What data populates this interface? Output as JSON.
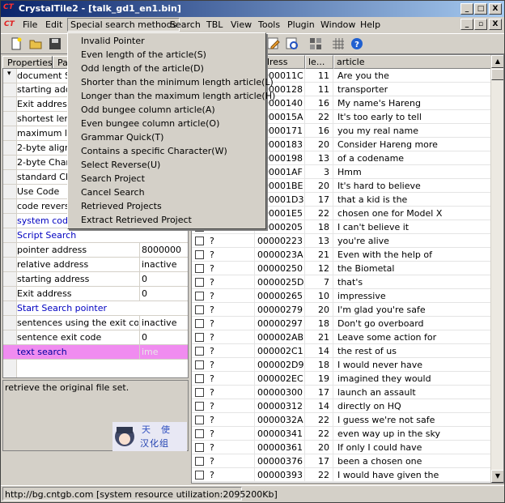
{
  "window": {
    "title": "CrystalTile2 - [talk_gd1_en1.bin]",
    "logo": "CT",
    "controls": [
      "_",
      "□",
      "X"
    ],
    "child_controls": [
      "_",
      "▫",
      "X"
    ]
  },
  "menubar": {
    "items": [
      "File",
      "Edit",
      "Special search methods",
      "Search",
      "TBL",
      "View",
      "Tools",
      "Plugin",
      "Window",
      "Help"
    ]
  },
  "dropdown": {
    "items": [
      "Invalid Pointer",
      "Even length of the article(S)",
      "Odd length of the article(D)",
      "Shorter than the minimum length article(L)",
      "Longer than the maximum length article(H)",
      "Odd bungee column article(A)",
      "Even bungee column article(O)",
      "Grammar Quick(T)",
      "Contains a specific Character(W)",
      "Select Reverse(U)",
      "Search Project",
      "Cancel Search",
      "Retrieved Projects",
      "Extract Retrieved Project"
    ]
  },
  "leftpanel": {
    "tabs": [
      "Properties",
      "Pa"
    ],
    "properties": [
      {
        "name": "document Se",
        "value": "",
        "type": "header"
      },
      {
        "name": "starting addr",
        "value": ""
      },
      {
        "name": "Exit address",
        "value": ""
      },
      {
        "name": "shortest leng",
        "value": ""
      },
      {
        "name": "maximum len",
        "value": ""
      },
      {
        "name": "2-byte alignm",
        "value": ""
      },
      {
        "name": "2-byte Chara",
        "value": ""
      },
      {
        "name": "standard Ch",
        "value": ""
      },
      {
        "name": "Use Code",
        "value": ""
      },
      {
        "name": "code reverse",
        "value": ""
      },
      {
        "name": "system code",
        "value": "",
        "type": "section"
      },
      {
        "name": "Script Search",
        "value": "",
        "type": "section"
      },
      {
        "name": "pointer address",
        "value": "8000000"
      },
      {
        "name": "relative address",
        "value": "inactive"
      },
      {
        "name": "starting address",
        "value": "0"
      },
      {
        "name": "Exit address",
        "value": "0"
      },
      {
        "name": "Start Search pointer",
        "value": "",
        "type": "section"
      },
      {
        "name": "sentences using the exit code",
        "value": "inactive"
      },
      {
        "name": "sentence exit code",
        "value": "0"
      },
      {
        "name": "text search",
        "value": "ime",
        "type": "highlight"
      }
    ],
    "description": "retrieve the original file set.",
    "mascot_text": [
      "天",
      "使",
      "汉化组"
    ]
  },
  "grid": {
    "columns": [
      "",
      "ddress",
      "le...",
      "article"
    ],
    "rows": [
      {
        "q": "",
        "address": "0000011C",
        "length": "11",
        "article": "Are you the"
      },
      {
        "q": "",
        "address": "00000128",
        "length": "11",
        "article": "transporter"
      },
      {
        "q": "",
        "address": "00000140",
        "length": "16",
        "article": "My name's Hareng"
      },
      {
        "q": "",
        "address": "0000015A",
        "length": "22",
        "article": "It's too early to tell"
      },
      {
        "q": "",
        "address": "00000171",
        "length": "16",
        "article": "you my real name"
      },
      {
        "q": "",
        "address": "00000183",
        "length": "20",
        "article": "Consider Hareng more"
      },
      {
        "q": "",
        "address": "00000198",
        "length": "13",
        "article": "of a codename"
      },
      {
        "q": "",
        "address": "000001AF",
        "length": "3",
        "article": "Hmm"
      },
      {
        "q": "",
        "address": "000001BE",
        "length": "20",
        "article": "It's hard to believe"
      },
      {
        "q": "",
        "address": "000001D3",
        "length": "17",
        "article": "that a kid is the"
      },
      {
        "q": "",
        "address": "000001E5",
        "length": "22",
        "article": "chosen one for Model X"
      },
      {
        "q": "?",
        "address": "00000205",
        "length": "18",
        "article": "I can't believe it"
      },
      {
        "q": "?",
        "address": "00000223",
        "length": "13",
        "article": " you're alive"
      },
      {
        "q": "?",
        "address": "0000023A",
        "length": "21",
        "article": "Even with the help of"
      },
      {
        "q": "?",
        "address": "00000250",
        "length": "12",
        "article": "the Biometal"
      },
      {
        "q": "?",
        "address": "0000025D",
        "length": "7",
        "article": " that's"
      },
      {
        "q": "?",
        "address": "00000265",
        "length": "10",
        "article": "impressive"
      },
      {
        "q": "?",
        "address": "00000279",
        "length": "20",
        "article": "I'm glad you're safe"
      },
      {
        "q": "?",
        "address": "00000297",
        "length": "18",
        "article": "Don't go overboard"
      },
      {
        "q": "?",
        "address": "000002AB",
        "length": "21",
        "article": "Leave some action for"
      },
      {
        "q": "?",
        "address": "000002C1",
        "length": "14",
        "article": "the rest of us"
      },
      {
        "q": "?",
        "address": "000002D9",
        "length": "18",
        "article": "I would never have"
      },
      {
        "q": "?",
        "address": "000002EC",
        "length": "19",
        "article": "imagined they would"
      },
      {
        "q": "?",
        "address": "00000300",
        "length": "17",
        "article": "launch an assault"
      },
      {
        "q": "?",
        "address": "00000312",
        "length": "14",
        "article": "directly on HQ"
      },
      {
        "q": "?",
        "address": "0000032A",
        "length": "22",
        "article": "I guess we're not safe"
      },
      {
        "q": "?",
        "address": "00000341",
        "length": "22",
        "article": "even way up in the sky"
      },
      {
        "q": "?",
        "address": "00000361",
        "length": "20",
        "article": "If only I could have"
      },
      {
        "q": "?",
        "address": "00000376",
        "length": "17",
        "article": "been a chosen one"
      },
      {
        "q": "?",
        "address": "00000393",
        "length": "22",
        "article": "I would have given the"
      }
    ]
  },
  "statusbar": {
    "text": "http://bg.cntgb.com [system resource utilization:2095200Kb]"
  },
  "colors": {
    "title_start": "#0a246a",
    "title_end": "#a6caf0",
    "highlight_row": "#f08cf0",
    "section_text": "#0000c0"
  }
}
